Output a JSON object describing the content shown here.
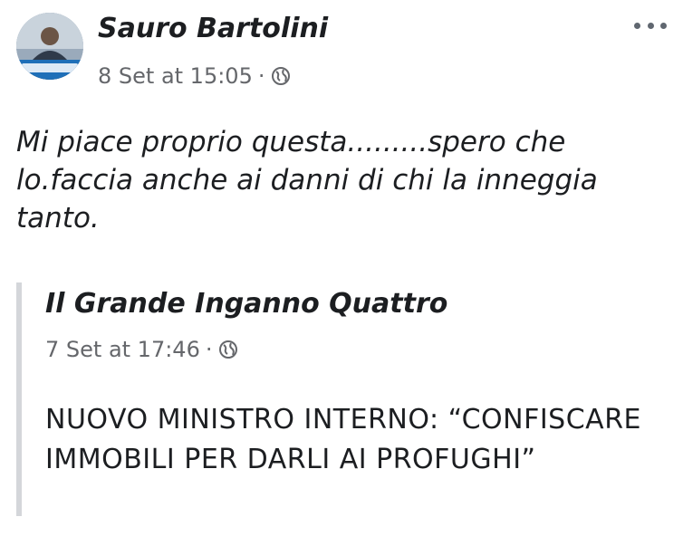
{
  "post": {
    "author_name": "Sauro Bartolini",
    "timestamp": "8 Set at 15:05",
    "separator": "·",
    "privacy_icon": "globe-icon",
    "more_icon": "more-options-icon",
    "text": "Mi piace proprio questa.........spero che lo.faccia anche ai danni di chi la inneggia tanto."
  },
  "shared_post": {
    "author_name": "Il Grande Inganno Quattro",
    "timestamp": "7 Set at 17:46",
    "separator": "·",
    "privacy_icon": "globe-icon",
    "text": "NUOVO MINISTRO INTERNO: “CONFISCARE IMMOBILI PER DARLI AI PROFUGHI”"
  },
  "colors": {
    "secondary_text": "#65676b",
    "primary_text": "#1c1e21",
    "quote_border": "#d4d6da"
  }
}
